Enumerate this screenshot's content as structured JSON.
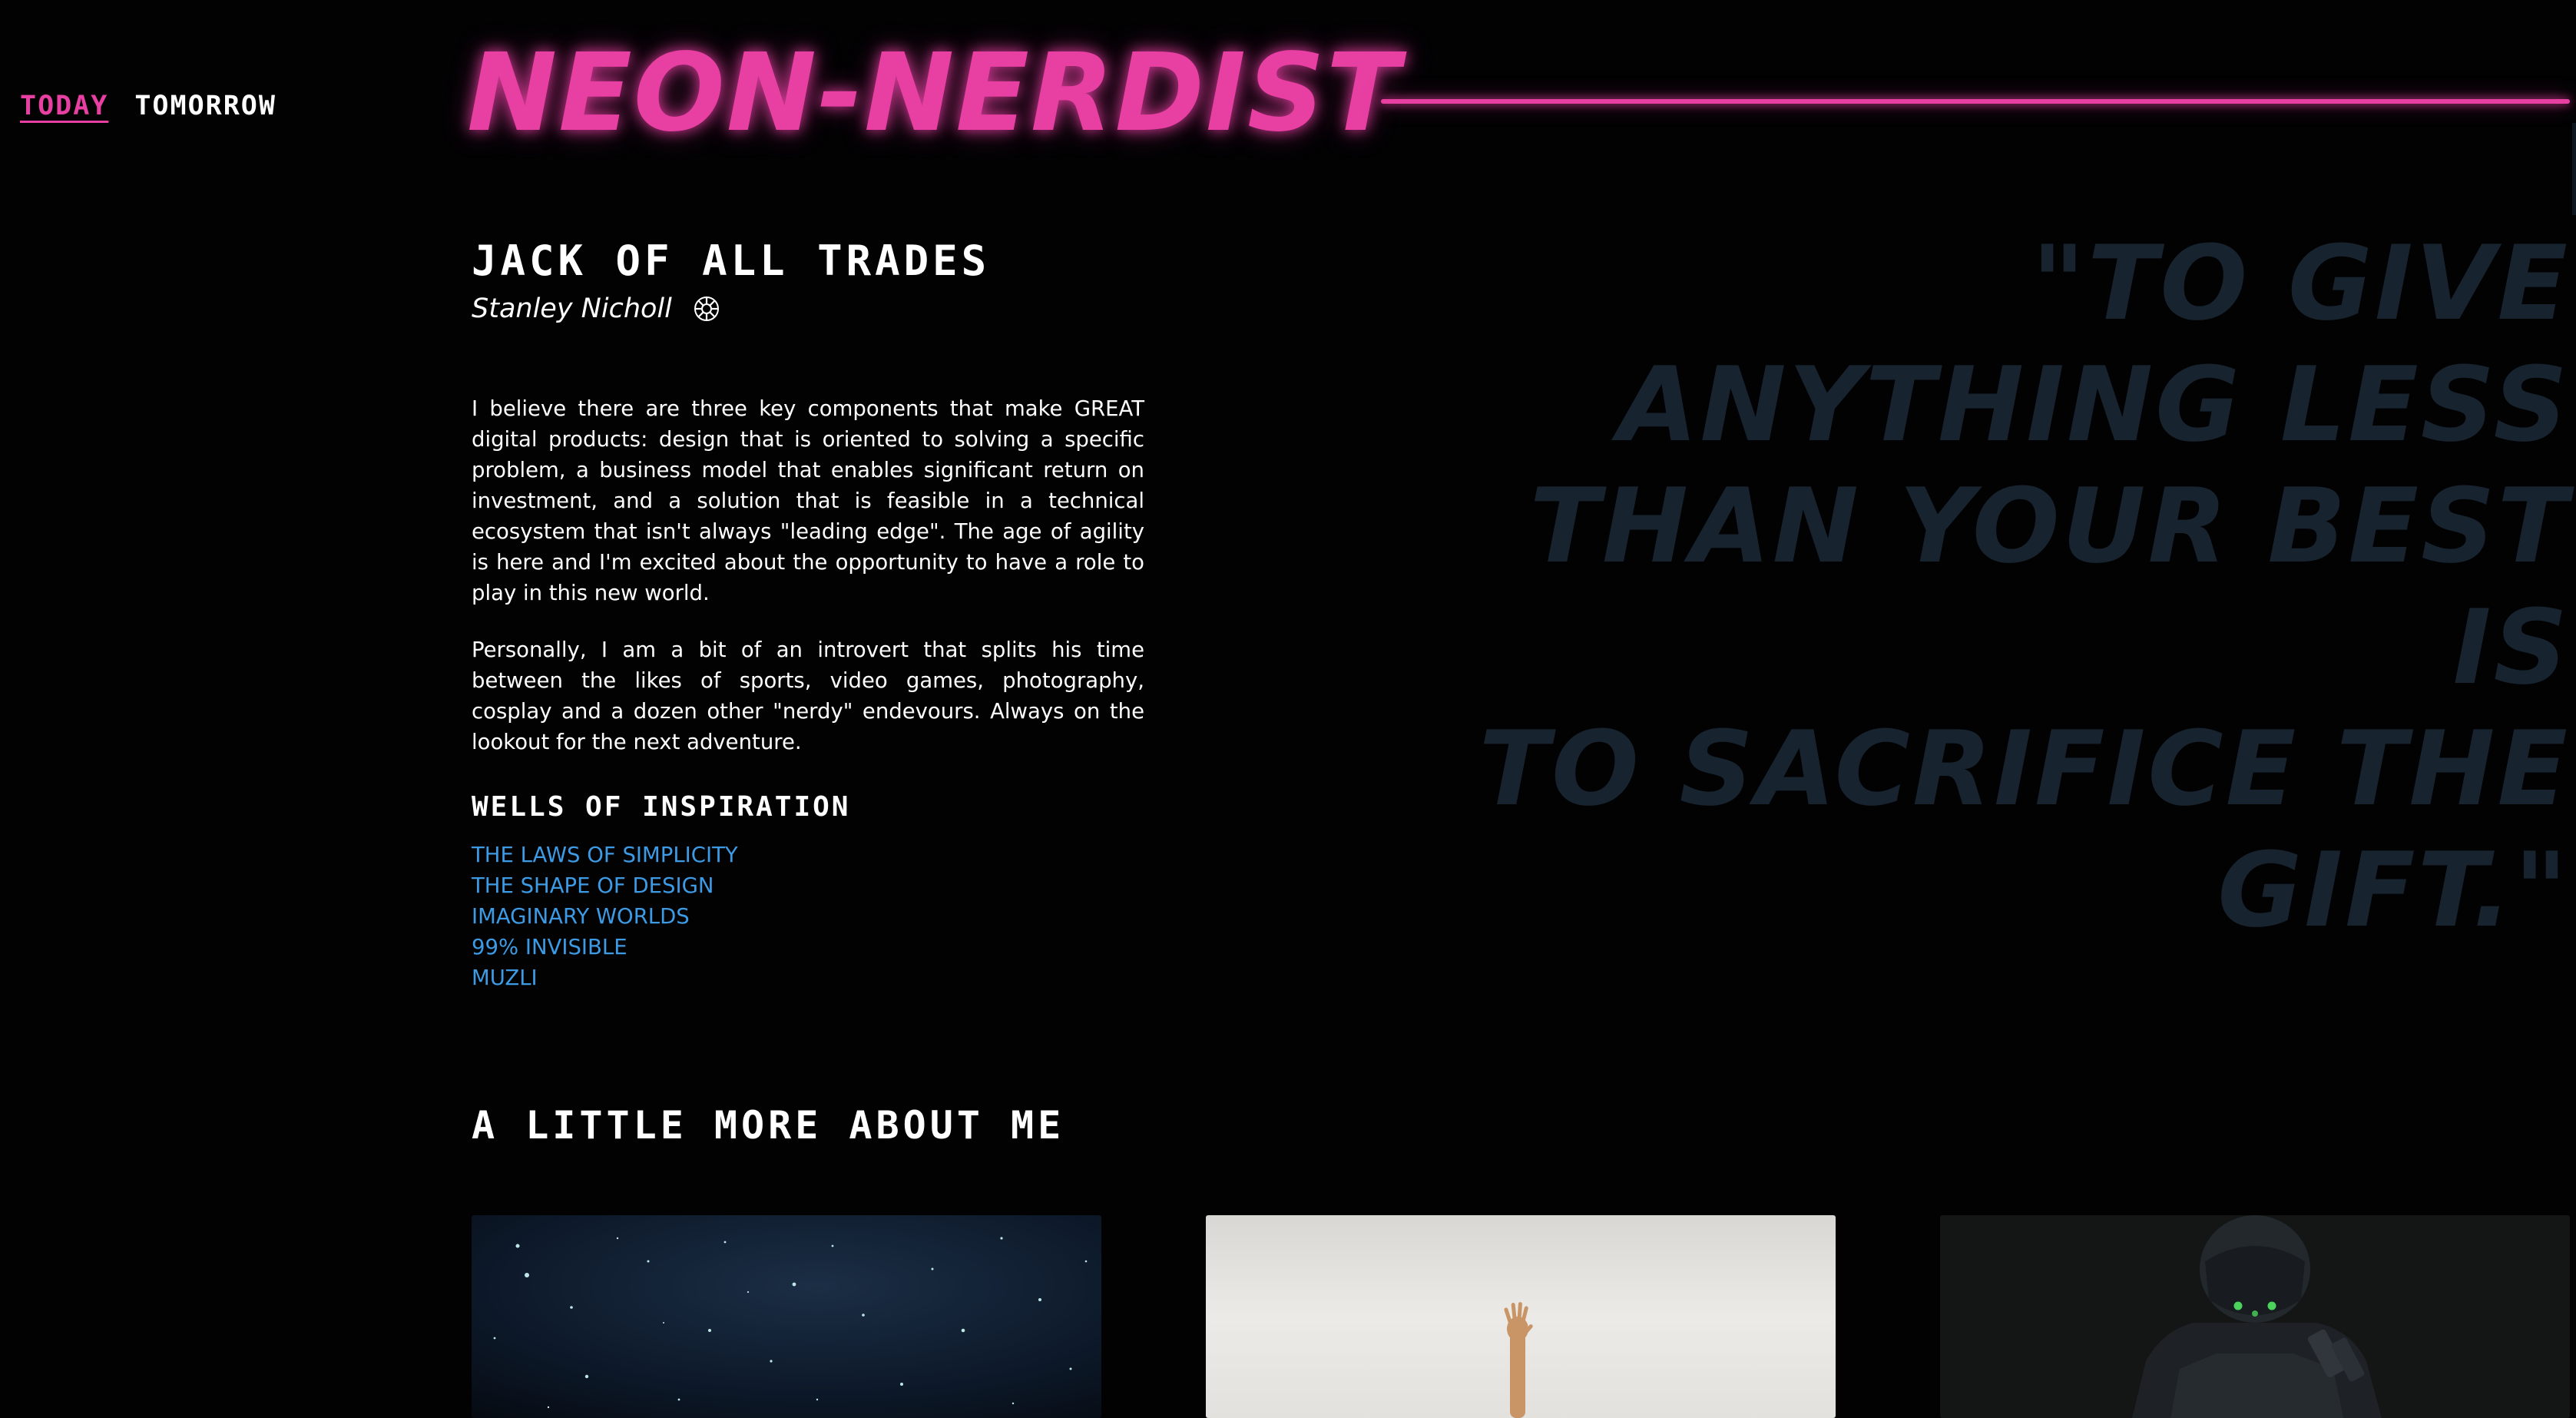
{
  "nav": {
    "items": [
      {
        "label": "TODAY",
        "active": true
      },
      {
        "label": "TOMORROW",
        "active": false
      }
    ]
  },
  "header": {
    "logo": "NEON-NERDIST"
  },
  "profile": {
    "title": "JACK OF ALL TRADES",
    "author": "Stanley Nicholl",
    "emblem_icon": "imperial-emblem-icon",
    "bio": [
      "I believe there are three key components that make GREAT digital products: design that is oriented to solving a specific problem, a business model that enables significant return on investment, and a solution that is feasible in a technical ecosystem that isn't always \"leading edge\". The age of agility is here and I'm excited about the opportunity to have a role to play in this new world.",
      "Personally, I am a bit of an introvert that splits his time between the likes of sports, video games, photography, cosplay and a dozen other \"nerdy\" endevours. Always on the lookout for the next adventure."
    ]
  },
  "inspiration": {
    "title": "WELLS OF INSPIRATION",
    "links": [
      "THE LAWS OF SIMPLICITY",
      "THE SHAPE OF DESIGN",
      "IMAGINARY WORLDS",
      "99% INVISIBLE",
      "MUZLI"
    ]
  },
  "quote": {
    "lines": [
      "\"TO GIVE",
      "ANYTHING LESS",
      "THAN YOUR BEST IS",
      "TO SACRIFICE THE",
      "GIFT.\""
    ]
  },
  "more": {
    "title": "A LITTLE MORE ABOUT ME",
    "cards": [
      "starry-night-photo",
      "raised-hand-photo",
      "death-trooper-cosplay-photo"
    ]
  },
  "colors": {
    "background": "#020203",
    "neon_pink": "#e83fa3",
    "link_blue": "#3d9be6",
    "quote_color": "#17232e",
    "text": "#ffffff"
  }
}
